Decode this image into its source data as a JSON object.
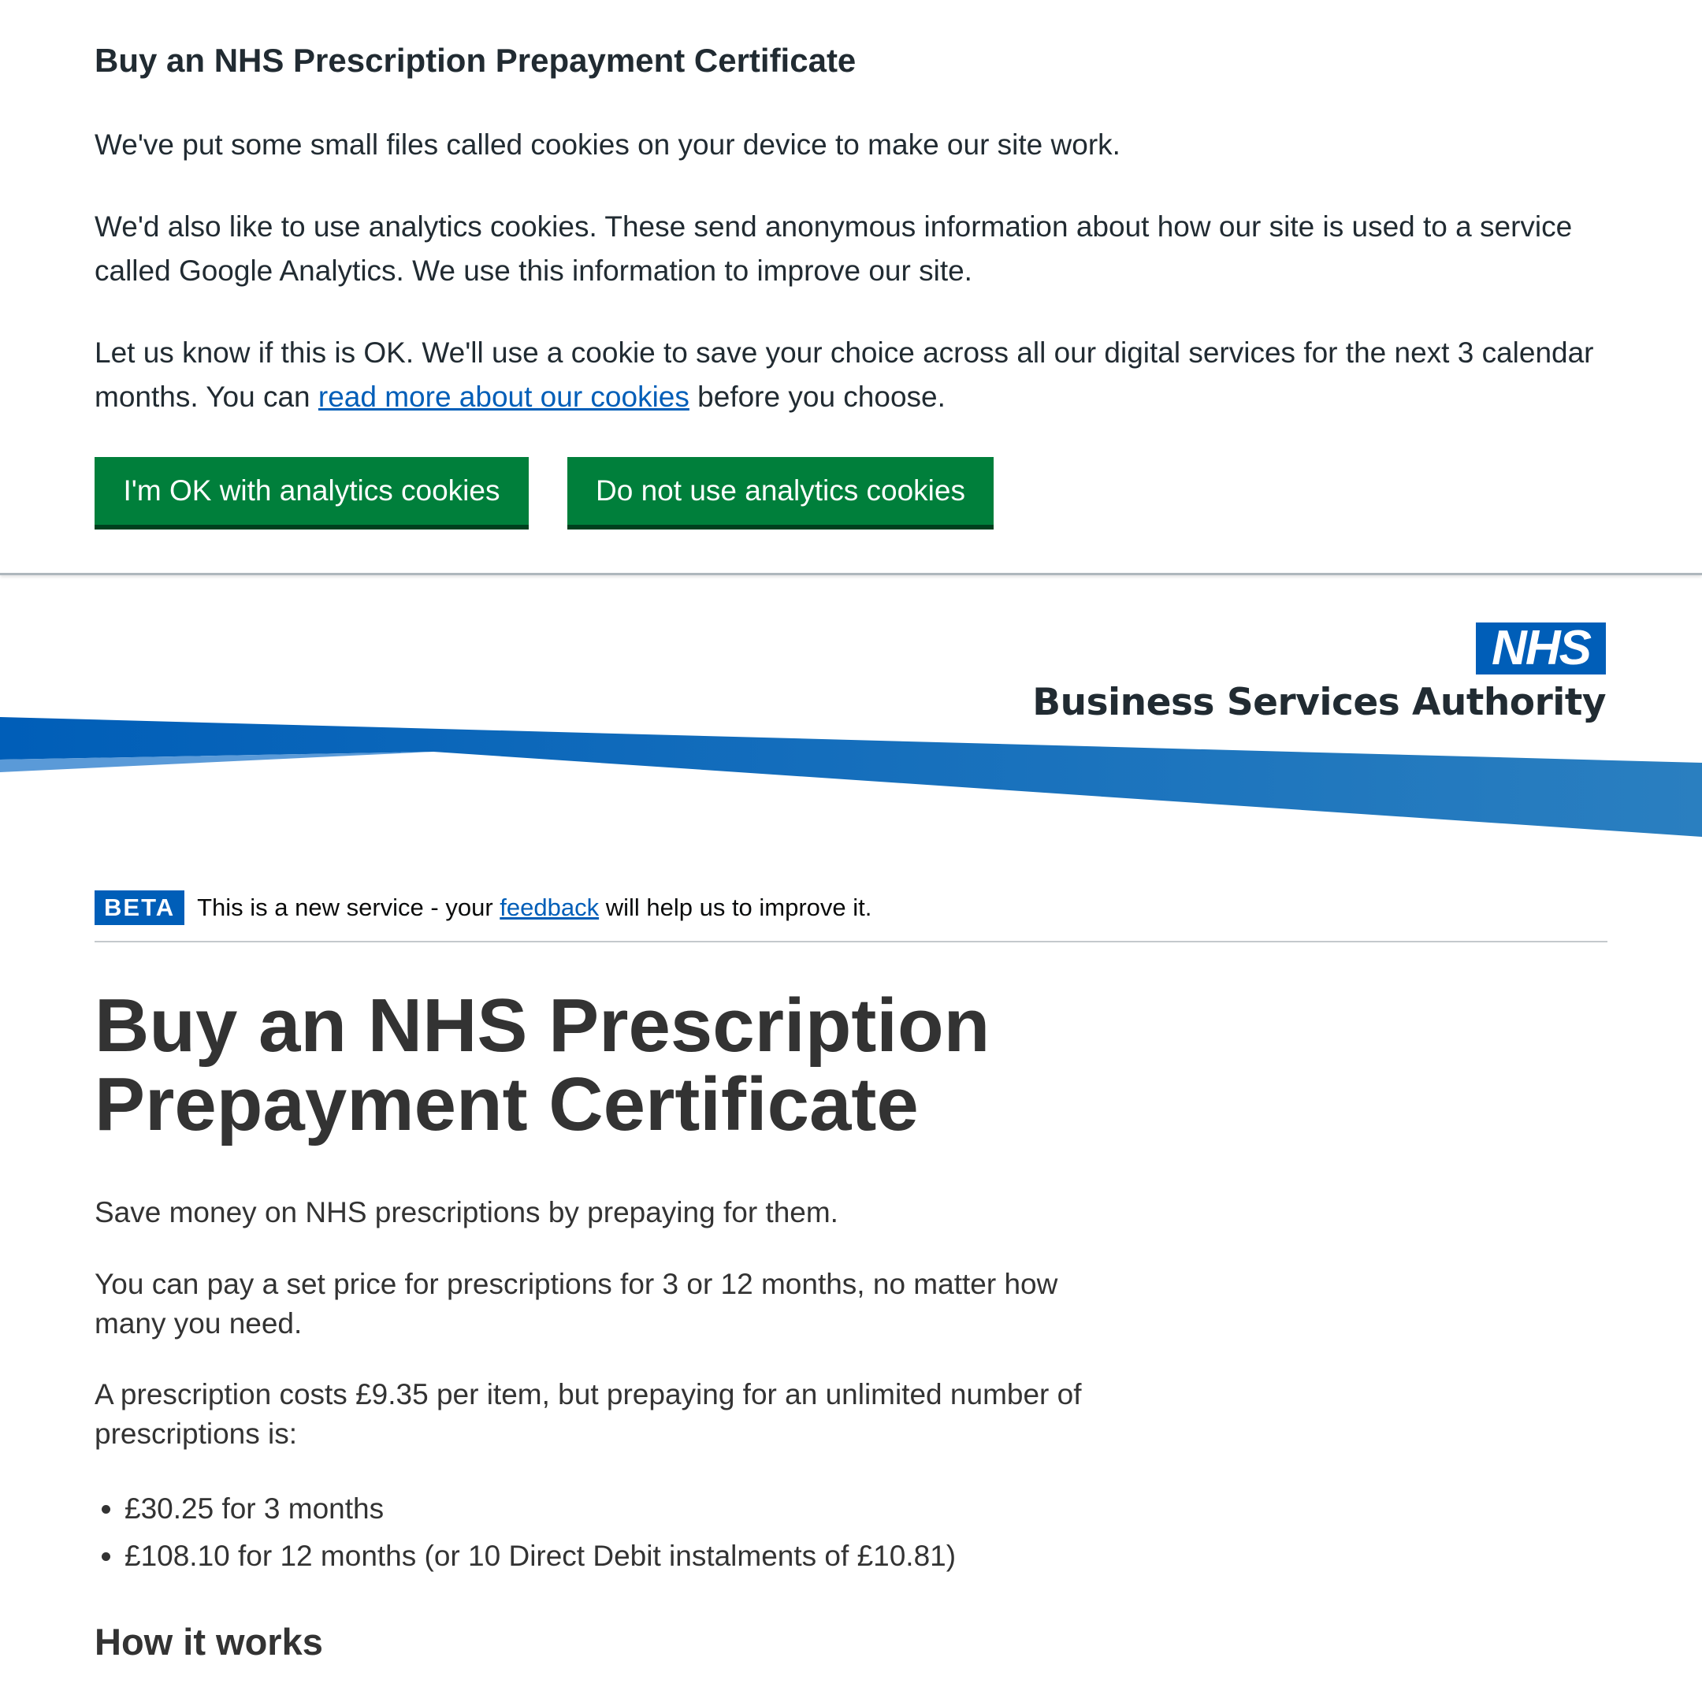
{
  "cookie_banner": {
    "heading": "Buy an NHS Prescription Prepayment Certificate",
    "paragraph1": "We've put some small files called cookies on your device to make our site work.",
    "paragraph2": "We'd also like to use analytics cookies. These send anonymous information about how our site is used to a service called Google Analytics. We use this information to improve our site.",
    "paragraph3_before": "Let us know if this is OK. We'll use a cookie to save your choice across all our digital services for the next 3 calendar months. You can ",
    "paragraph3_link": "read more about our cookies",
    "paragraph3_after": " before you choose.",
    "accept_label": "I'm OK with analytics cookies",
    "reject_label": "Do not use analytics cookies"
  },
  "header": {
    "logo_text": "NHS",
    "org_name": "Business Services Authority",
    "colors": {
      "nhs_blue": "#005eb8",
      "swoosh_light": "#41b6e6"
    }
  },
  "beta_banner": {
    "tag": "BETA",
    "text_before": "This is a new service - your ",
    "link": "feedback",
    "text_after": " will help us to improve it."
  },
  "main": {
    "title": "Buy an NHS Prescription Prepayment Certificate",
    "intro1": "Save money on NHS prescriptions by prepaying for them.",
    "intro2": "You can pay a set price for prescriptions for 3 or 12 months, no matter how many you need.",
    "intro3": "A prescription costs £9.35 per item, but prepaying for an unlimited number of prescriptions is:",
    "bullets": [
      "£30.25 for 3 months",
      "£108.10 for 12 months (or 10 Direct Debit instalments of £10.81)"
    ],
    "how_it_works": "How it works"
  },
  "colors": {
    "button_green": "#007f3b",
    "button_shadow": "#00401e",
    "link_blue": "#005eb8",
    "text": "#212b32"
  }
}
